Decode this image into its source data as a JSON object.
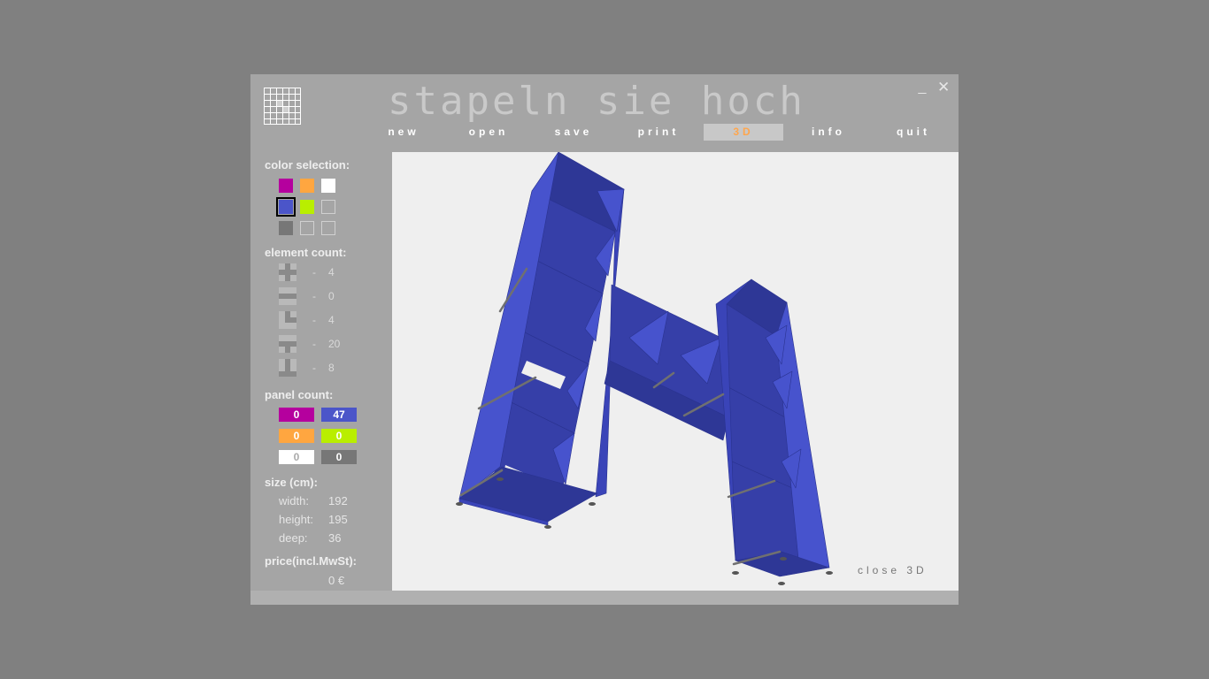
{
  "app": {
    "title": "stapeln sie hoch",
    "minimize_glyph": "_",
    "close_glyph": "✕"
  },
  "menu": [
    {
      "label": "new"
    },
    {
      "label": "open"
    },
    {
      "label": "save"
    },
    {
      "label": "print"
    },
    {
      "label": "3D",
      "active": true
    },
    {
      "label": "info"
    },
    {
      "label": "quit"
    }
  ],
  "sidebar": {
    "color_selection": {
      "title": "color selection:",
      "swatches": [
        "#b5009e",
        "#ffa640",
        "#ffffff",
        "#4b55c9",
        "#b9ee00",
        "",
        "#777777",
        "",
        ""
      ],
      "selected_index": 3
    },
    "element_count": {
      "title": "element count:",
      "items": [
        {
          "icon": "cross-element-icon",
          "dash": "-",
          "value": "4"
        },
        {
          "icon": "bar-element-icon",
          "dash": "-",
          "value": "0"
        },
        {
          "icon": "corner-element-icon",
          "dash": "-",
          "value": "4"
        },
        {
          "icon": "t-element-icon",
          "dash": "-",
          "value": "20"
        },
        {
          "icon": "l-element-icon",
          "dash": "-",
          "value": "8"
        }
      ]
    },
    "panel_count": {
      "title": "panel count:",
      "boxes": [
        {
          "value": "0",
          "color": "#b5009e"
        },
        {
          "value": "47",
          "color": "#4b55c9"
        },
        {
          "value": "0",
          "color": "#ffa640"
        },
        {
          "value": "0",
          "color": "#b9ee00"
        },
        {
          "value": "0",
          "color": "#ffffff"
        },
        {
          "value": "0",
          "color": "#777777"
        }
      ]
    },
    "size": {
      "title": "size (cm):",
      "width_label": "width:",
      "width": "192",
      "height_label": "height:",
      "height": "195",
      "deep_label": "deep:",
      "deep": "36"
    },
    "price": {
      "title": "price(incl.MwSt):",
      "value": "0 €"
    }
  },
  "viewport": {
    "close_label": "close 3D",
    "shelf_color": "#3f49c4"
  }
}
